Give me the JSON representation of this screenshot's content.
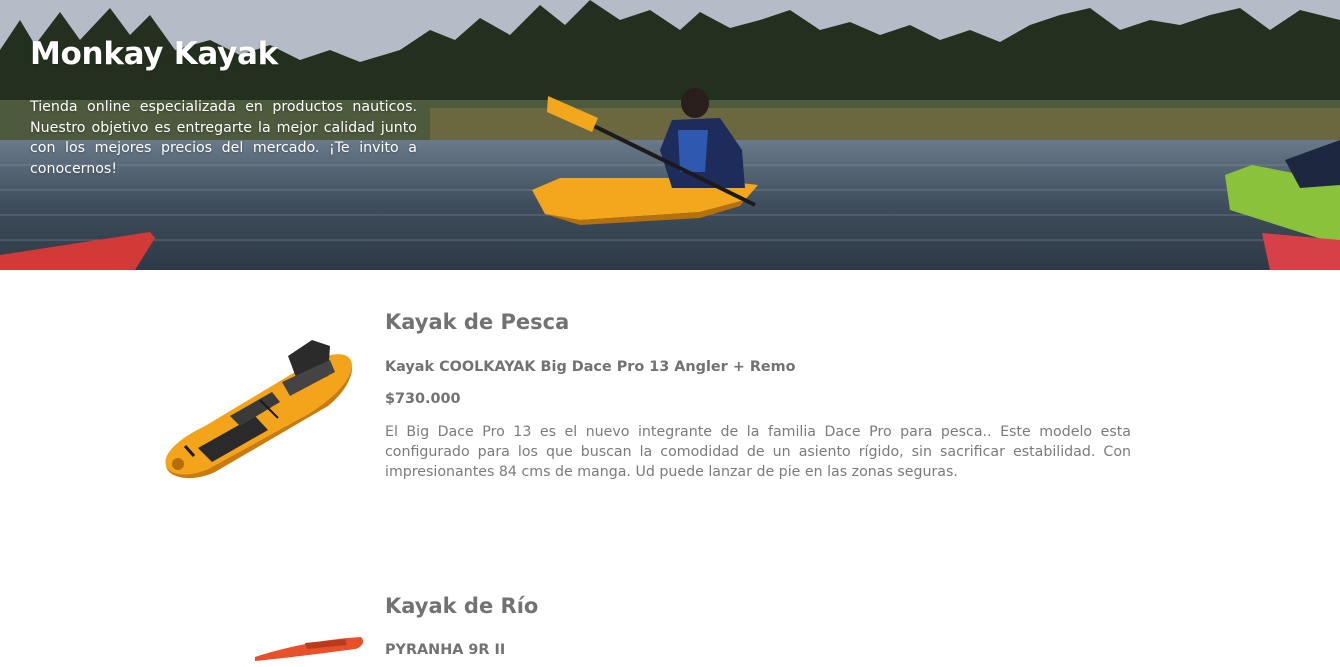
{
  "header": {
    "title": "Monkay Kayak",
    "description": "Tienda online especializada en productos nauticos. Nuestro objetivo es entregarte la mejor calidad junto con los mejores precios del mercado. ¡Te invito a conocernos!"
  },
  "products": [
    {
      "category": "Kayak de Pesca",
      "name": "Kayak COOLKAYAK Big Dace Pro 13 Angler + Remo",
      "price": "$730.000",
      "description": "El Big Dace Pro 13 es el nuevo integrante de la familia Dace Pro para pesca.. Este modelo esta configurado para los que buscan la comodidad de un asiento rígido, sin sacrificar estabilidad. Con impresionantes 84 cms de manga. Ud puede lanzar de pie en las zonas seguras.",
      "image": "yellow-fishing-kayak"
    },
    {
      "category": "Kayak de Río",
      "name": "PYRANHA 9R II",
      "image": "orange-river-kayak"
    }
  ],
  "colors": {
    "text_gray": "#727272",
    "hero_text": "#ffffff",
    "kayak_yellow": "#f3a41b",
    "kayak_orange": "#e8502a"
  }
}
